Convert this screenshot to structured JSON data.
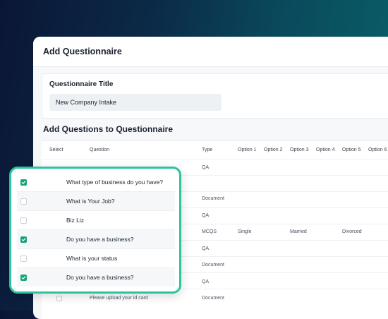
{
  "panel": {
    "title": "Add Questionnaire"
  },
  "questionnaire": {
    "title_label": "Questionnaire Title",
    "title_value": "New Company Intake"
  },
  "section": {
    "title": "Add Questions to Questionnaire"
  },
  "table": {
    "headers": {
      "select": "Select",
      "question": "Question",
      "type": "Type",
      "option1": "Option 1",
      "option2": "Option 2",
      "option3": "Option 3",
      "option4": "Option 4",
      "option5": "Option 5",
      "option6": "Option 6"
    },
    "rows": [
      {
        "type": "QA"
      },
      {
        "type": ""
      },
      {
        "type": "Document"
      },
      {
        "type": "QA"
      },
      {
        "type": "MCQS",
        "option1": "Single",
        "option3": "Married",
        "option5": "Divorced"
      },
      {
        "type": "QA"
      },
      {
        "type": "Document"
      },
      {
        "type": "QA"
      },
      {
        "question": "Please upload your id card",
        "type": "Document"
      }
    ]
  },
  "callout": {
    "rows": [
      {
        "question": "What type of business do you have?",
        "checked": true
      },
      {
        "question": "What is Your Job?",
        "checked": false
      },
      {
        "question": "Biz Liz",
        "checked": false
      },
      {
        "question": "Do you have a business?",
        "checked": true
      },
      {
        "question": "What is your status",
        "checked": false
      },
      {
        "question": "Do you have a business?",
        "checked": true
      }
    ]
  },
  "colors": {
    "accent": "#2bc4a0",
    "checkbox_checked": "#13a37a",
    "background_dark": "#0b1636",
    "background_teal": "#08636a"
  }
}
